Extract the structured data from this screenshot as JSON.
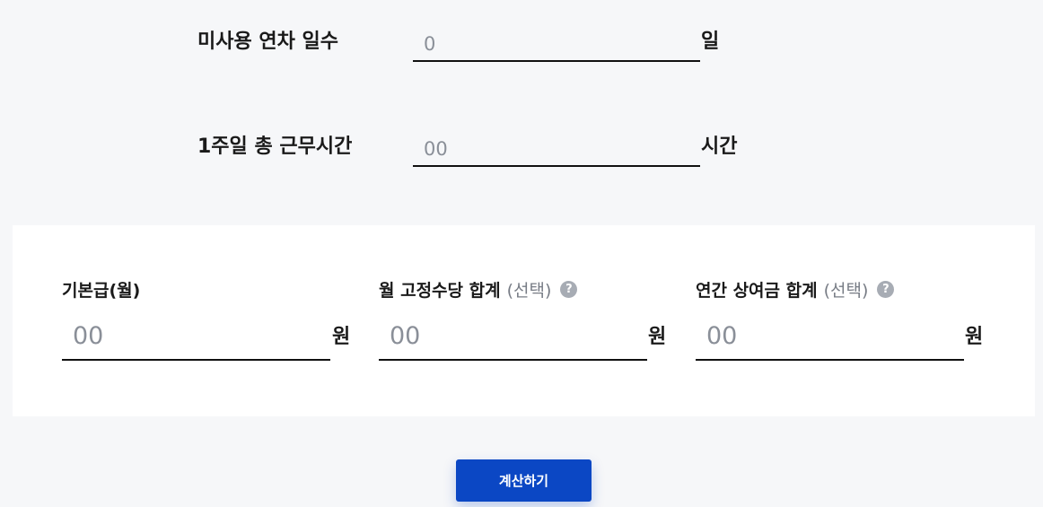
{
  "unused_leave": {
    "label": "미사용 연차 일수",
    "placeholder": "0",
    "unit": "일"
  },
  "weekly_hours": {
    "label": "1주일 총 근무시간",
    "placeholder": "00",
    "unit": "시간"
  },
  "salary_fields": [
    {
      "label": "기본급(월)",
      "optional": "",
      "placeholder": "00",
      "unit": "원"
    },
    {
      "label": "월 고정수당 합계",
      "optional": "(선택)",
      "placeholder": "00",
      "unit": "원"
    },
    {
      "label": "연간 상여금 합계",
      "optional": "(선택)",
      "placeholder": "00",
      "unit": "원"
    }
  ],
  "help_icon_glyph": "?",
  "calculate_button": {
    "label": "계산하기"
  },
  "colors": {
    "page_background": "#f6f7f9",
    "card_background": "#ffffff",
    "accent": "#0b47c4",
    "help_icon": "#a7acb4"
  }
}
